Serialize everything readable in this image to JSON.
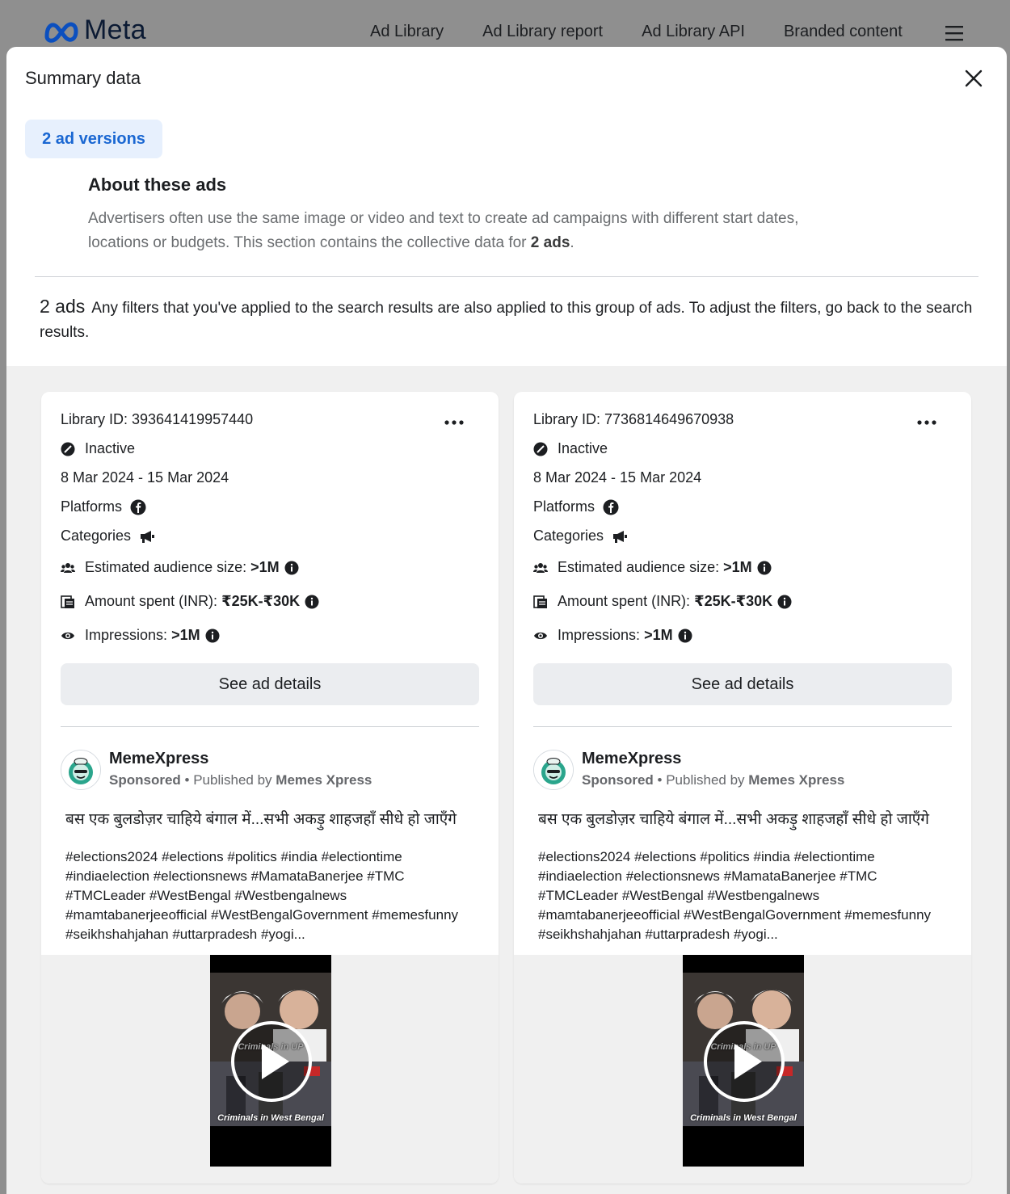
{
  "header": {
    "brand": "Meta",
    "nav": [
      "Ad Library",
      "Ad Library report",
      "Ad Library API",
      "Branded content"
    ]
  },
  "modal": {
    "title": "Summary data",
    "versions_tab": "2 ad versions",
    "about_title": "About these ads",
    "about_text": "Advertisers often use the same image or video and text to create ad campaigns with different start dates, locations or budgets. This section contains the collective data for",
    "about_count": "2 ads",
    "ads_count": "2 ads",
    "ads_note": "Any filters that you've applied to the search results are also applied to this group of ads. To adjust the filters, go back to the search results."
  },
  "cards": [
    {
      "library_id": "Library ID: 393641419957440",
      "status": "Inactive",
      "dates": "8 Mar 2024 - 15 Mar 2024",
      "platforms_label": "Platforms",
      "categories_label": "Categories",
      "audience_label": "Estimated audience size:",
      "audience_value": ">1M",
      "spent_label": "Amount spent (INR):",
      "spent_value": "₹25K-₹30K",
      "impressions_label": "Impressions:",
      "impressions_value": ">1M",
      "details_button": "See ad details",
      "page_name": "MemeXpress",
      "sponsored": "Sponsored",
      "published_by": "• Published by",
      "publisher": "Memes Xpress",
      "ad_text": "बस एक बुलडोज़र चाहिये बंगाल में...सभी अकड़ु शाहजहाँ सीधे हो जाएँगे",
      "hashtags": "#elections2024 #elections #politics #india #electiontime #indiaelection #electionsnews #MamataBanerjee #TMC #TMCLeader #WestBengal #Westbengalnews #mamtabanerjeeofficial #WestBengalGovernment #memesfunny #seikhshahjahan #uttarpradesh #yogi...",
      "video_caption_top": "Criminals in UP",
      "video_caption_bottom": "Criminals in West Bengal"
    },
    {
      "library_id": "Library ID: 7736814649670938",
      "status": "Inactive",
      "dates": "8 Mar 2024 - 15 Mar 2024",
      "platforms_label": "Platforms",
      "categories_label": "Categories",
      "audience_label": "Estimated audience size:",
      "audience_value": ">1M",
      "spent_label": "Amount spent (INR):",
      "spent_value": "₹25K-₹30K",
      "impressions_label": "Impressions:",
      "impressions_value": ">1M",
      "details_button": "See ad details",
      "page_name": "MemeXpress",
      "sponsored": "Sponsored",
      "published_by": "• Published by",
      "publisher": "Memes Xpress",
      "ad_text": "बस एक बुलडोज़र चाहिये बंगाल में...सभी अकड़ु शाहजहाँ सीधे हो जाएँगे",
      "hashtags": "#elections2024 #elections #politics #india #electiontime #indiaelection #electionsnews #MamataBanerjee #TMC #TMCLeader #WestBengal #Westbengalnews #mamtabanerjeeofficial #WestBengalGovernment #memesfunny #seikhshahjahan #uttarpradesh #yogi...",
      "video_caption_top": "Criminals in UP",
      "video_caption_bottom": "Criminals in West Bengal"
    }
  ],
  "colors": {
    "accent": "#1a67d2",
    "tab_bg": "#e7f0fd",
    "brand_blue": "#0064e0"
  },
  "icons": [
    "meta-logo-icon",
    "menu-icon",
    "close-icon",
    "more-options-icon",
    "inactive-icon",
    "facebook-icon",
    "megaphone-icon",
    "audience-icon",
    "money-icon",
    "eye-icon",
    "info-icon",
    "play-icon"
  ]
}
